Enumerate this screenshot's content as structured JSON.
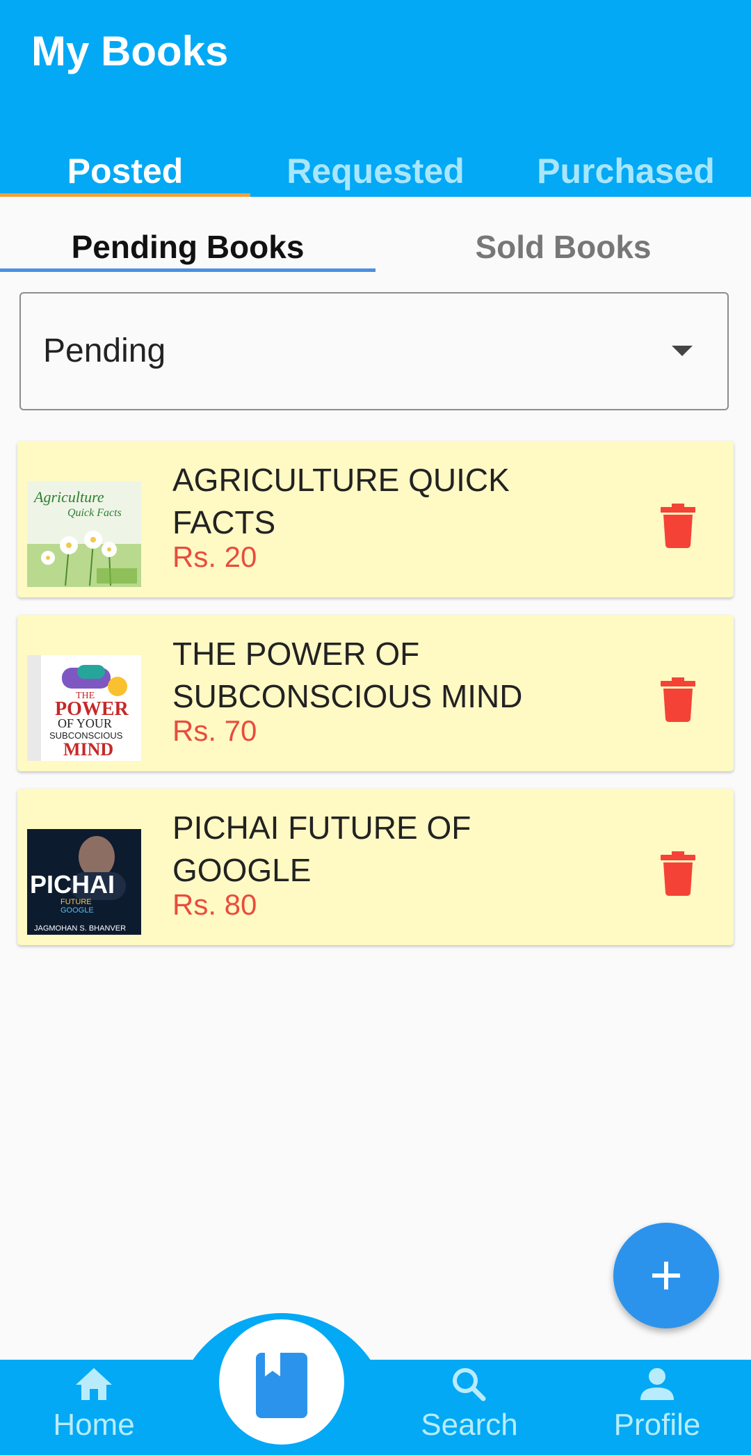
{
  "header": {
    "title": "My Books"
  },
  "top_tabs": [
    {
      "label": "Posted",
      "active": true
    },
    {
      "label": "Requested",
      "active": false
    },
    {
      "label": "Purchased",
      "active": false
    }
  ],
  "sub_tabs": [
    {
      "label": "Pending Books",
      "active": true
    },
    {
      "label": "Sold Books",
      "active": false
    }
  ],
  "filter": {
    "selected": "Pending"
  },
  "books": [
    {
      "title": "AGRICULTURE QUICK FACTS",
      "price": "Rs. 20",
      "cover": {
        "line1": "Agriculture",
        "line2": "Quick Facts"
      }
    },
    {
      "title": "THE POWER OF SUBCONSCIOUS MIND",
      "price": "Rs. 70",
      "cover": {
        "line1": "THE",
        "line2": "POWER",
        "line3": "OF YOUR",
        "line4": "SUBCONSCIOUS",
        "line5": "MIND"
      }
    },
    {
      "title": "PICHAI FUTURE OF GOOGLE",
      "price": "Rs. 80",
      "cover": {
        "line1": "PICHAI",
        "line2": "FUTURE",
        "line3": "GOOGLE",
        "line4": "JAGMOHAN S. BHANVER"
      }
    }
  ],
  "fab": {
    "icon": "plus-icon"
  },
  "bottom_nav": [
    {
      "label": "Home",
      "icon": "home-icon"
    },
    {
      "label": "",
      "icon": "book-icon"
    },
    {
      "label": "Search",
      "icon": "search-icon"
    },
    {
      "label": "Profile",
      "icon": "person-icon"
    }
  ],
  "colors": {
    "primary": "#03a9f4",
    "tab_indicator": "#f0a13b",
    "subtab_indicator": "#4a90e2",
    "card_bg": "#fff9c4",
    "price": "#e84c3d",
    "delete": "#f44336",
    "fab": "#2b93ec"
  }
}
